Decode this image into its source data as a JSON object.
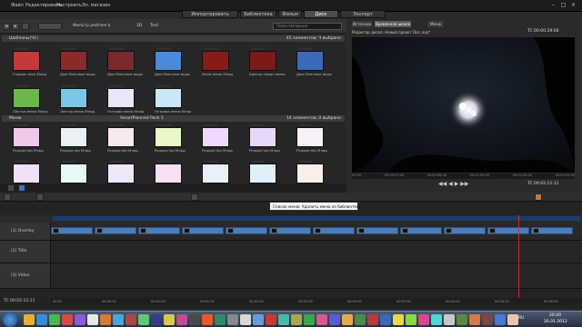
{
  "menu": [
    "Файл",
    "Редактировать",
    "Настроить",
    "Эл. магазин"
  ],
  "modes": [
    {
      "label": "Импортировать",
      "active": false
    },
    {
      "label": "Библиотека",
      "active": false
    },
    {
      "label": "Фильм",
      "active": false
    },
    {
      "label": "Диск",
      "active": true
    },
    {
      "label": "Экспорт",
      "active": false
    }
  ],
  "library": {
    "collection_label": "Фильтр рейтинга",
    "view_3d": "3D",
    "view_text": "Text",
    "search_placeholder": "Поиск:Названия",
    "section1": {
      "title": "Шаблоны(Ч1)",
      "count": "45 элементов; Ч выбрано"
    },
    "section2": {
      "title": "Меню",
      "count": "14 элементов; 0 выбрано"
    },
    "row1_labels": [
      "Горные леса Млад",
      "Дом Млечные воды",
      "Дом Млечные воды",
      "Дом Млечные воды",
      "Иней меню Млад",
      "Кресло смерч меню",
      "Дом Млечные воды"
    ],
    "row2_labels": [
      "Листья меню Млад",
      "Листья меню Млад",
      "Острова меню Млад",
      "Острова меню Млад"
    ],
    "row3_labels": [
      "Рождество Млад",
      "Рождество Млад",
      "Рождество Млад",
      "Рождество Млад",
      "Рождество Млад",
      "Рождество Млад",
      "Рождество Млад"
    ],
    "row4_labels": [
      "",
      "",
      "",
      "",
      "",
      "",
      ""
    ],
    "section2_sub": "SmartPlanned Pack 1"
  },
  "preview": {
    "tab1": "Источник",
    "tab2": "Временная шкала",
    "tab3": "Меню",
    "project_label": "Редактор диска: Новый проект Disc.axp*",
    "timecode": "TC 00:00:29:00",
    "timecode2": "TC 00:02:12:11",
    "ruler_ticks": [
      "00:00",
      "00:00:07:00",
      "00:00:08:00",
      "00:01:00:00",
      "00:02:00:00",
      "00:03:00:00"
    ]
  },
  "timeline": {
    "tracks": [
      {
        "num": "1",
        "name": "(1) Overlay"
      },
      {
        "num": "2",
        "name": "(2) Title"
      },
      {
        "num": "3",
        "name": "(3) Video"
      }
    ],
    "timecode": "TC 00:02:12:11",
    "tooltip": "Список меню: Удалить меню из библиотеки",
    "ruler_ticks": [
      "00:00",
      "00:00:30",
      "00:01:00",
      "00:01:30",
      "00:02:00",
      "00:02:30",
      "00:03:00",
      "00:03:30",
      "00:04:00",
      "00:04:30",
      "00:05:00"
    ]
  },
  "taskbar": {
    "time": "20:20",
    "date": "26.01.2012",
    "lang": "RU"
  }
}
